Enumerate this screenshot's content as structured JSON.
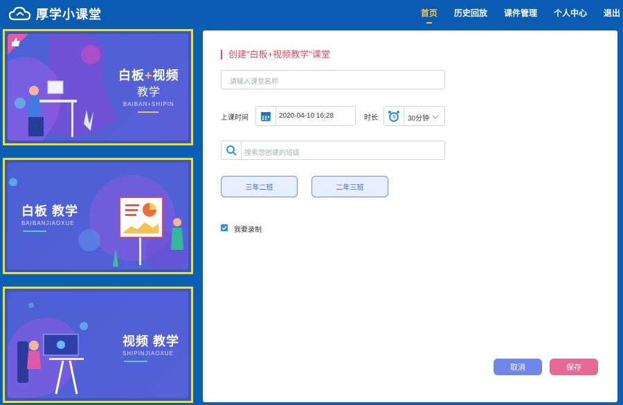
{
  "header": {
    "app_name": "厚学小课堂",
    "nav": [
      "首页",
      "历史回放",
      "课件管理",
      "个人中心",
      "退出"
    ]
  },
  "cards": [
    {
      "title_a": "白板",
      "title_plus": "+",
      "title_b": "视频",
      "title_2": "教学",
      "subtitle": "BAIBAN+SHIPIN"
    },
    {
      "title": "白板 教学",
      "subtitle": "BAIBANJIAOXUE"
    },
    {
      "title": "视频 教学",
      "subtitle": "SHIPINJIAOXUE"
    }
  ],
  "form": {
    "section_title": "创建\"白板+视频教学\"课堂",
    "name_placeholder": "请输入课堂名称",
    "time_label": "上课时间",
    "time_value": "2020-04-10 16:28",
    "duration_label": "时长",
    "duration_value": "30分钟",
    "search_placeholder": "搜索您创建的班级",
    "classes": [
      "三年二班",
      "二年三班"
    ],
    "record_label": "我要录制",
    "record_checked": true,
    "cancel_label": "取消",
    "save_label": "保存"
  },
  "colors": {
    "header_bg": "#0a5cb3",
    "nav_active": "#f5c64a",
    "accent_pink": "#e04a63",
    "cancel_bg": "#6f86ea",
    "save_bg": "#e86a94",
    "card_border": "#f2e21b"
  }
}
